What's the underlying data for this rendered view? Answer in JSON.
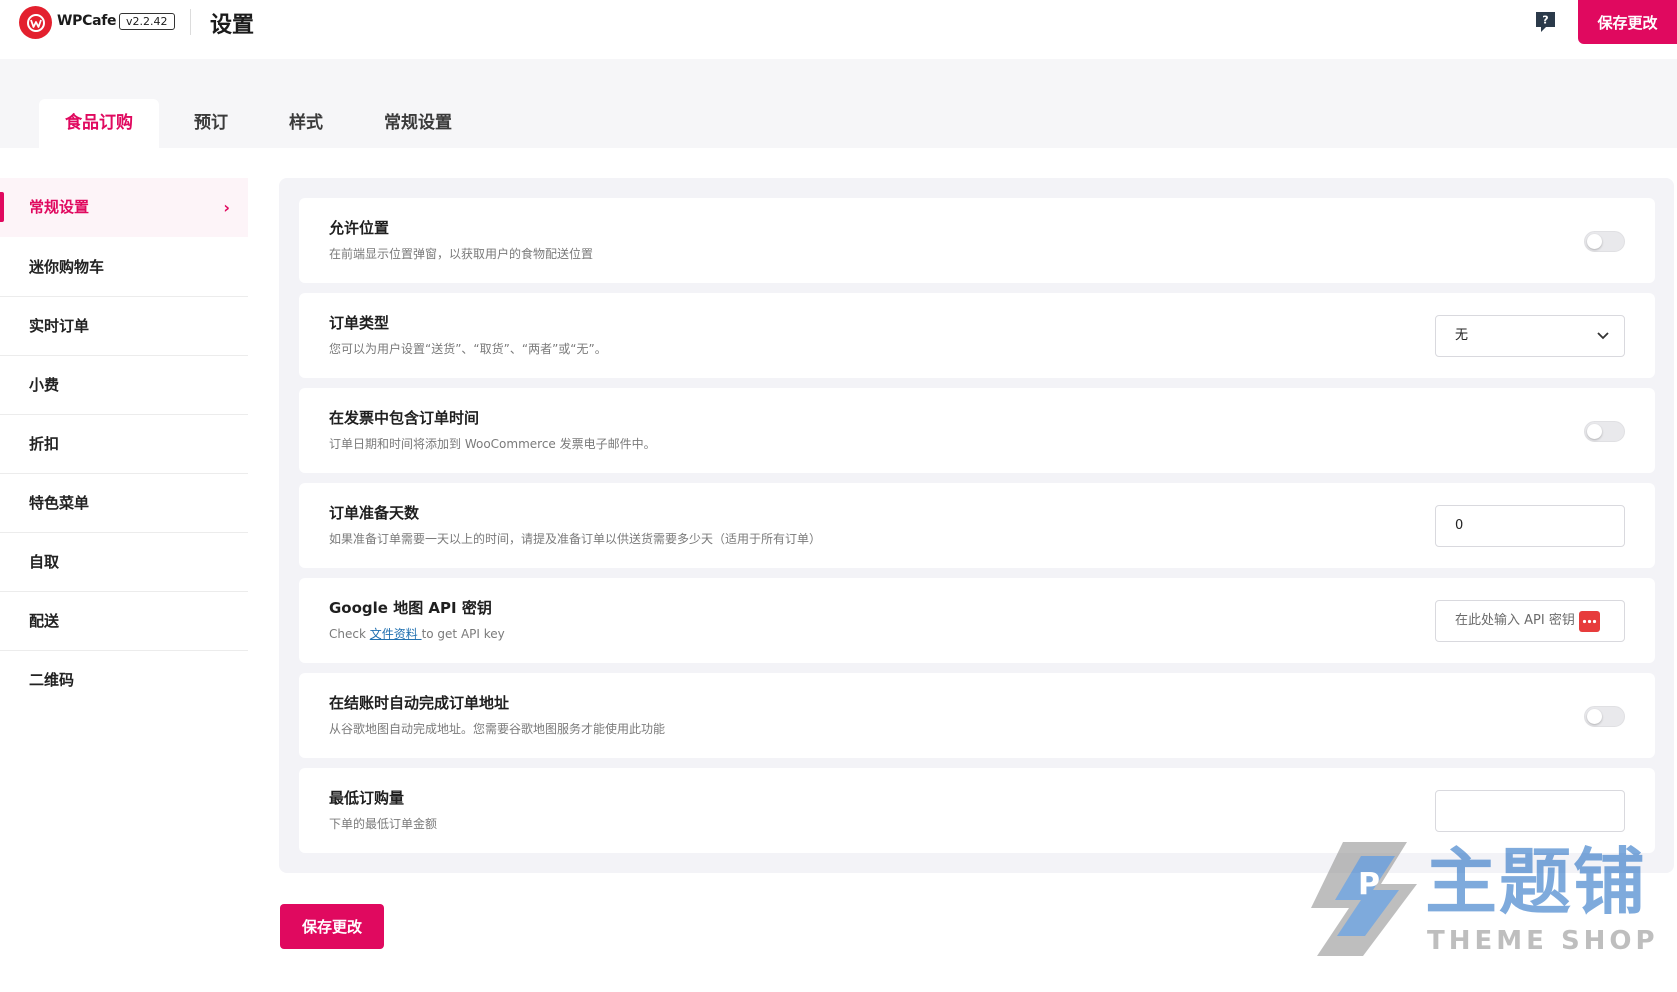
{
  "app": {
    "brand": "WPCafe",
    "version": "v2.2.42",
    "page_title": "设置",
    "save_label": "保存更改",
    "brand_color": "#e0095f"
  },
  "tabs": [
    {
      "label": "食品订购",
      "active": true
    },
    {
      "label": "预订",
      "active": false
    },
    {
      "label": "样式",
      "active": false
    },
    {
      "label": "常规设置",
      "active": false
    }
  ],
  "sidebar": {
    "items": [
      {
        "label": "常规设置",
        "active": true
      },
      {
        "label": "迷你购物车"
      },
      {
        "label": "实时订单"
      },
      {
        "label": "小费"
      },
      {
        "label": "折扣"
      },
      {
        "label": "特色菜单"
      },
      {
        "label": "自取"
      },
      {
        "label": "配送"
      },
      {
        "label": "二维码"
      }
    ]
  },
  "settings": [
    {
      "title": "允许位置",
      "desc": "在前端显示位置弹窗，以获取用户的食物配送位置",
      "control": "toggle",
      "enabled": false
    },
    {
      "title": "订单类型",
      "desc": "您可以为用户设置“送货”、“取货”、“两者”或“无”。",
      "control": "select",
      "value": "无"
    },
    {
      "title": "在发票中包含订单时间",
      "desc": "订单日期和时间将添加到 WooCommerce 发票电子邮件中。",
      "control": "toggle",
      "enabled": false
    },
    {
      "title": "订单准备天数",
      "desc": "如果准备订单需要一天以上的时间，请提及准备订单以供送货需要多少天（适用于所有订单）",
      "control": "input",
      "value": "0"
    },
    {
      "title": "Google 地图 API 密钥",
      "desc_prefix": "Check ",
      "desc_link": "文件资料 ",
      "desc_suffix": "to get API key",
      "control": "input",
      "placeholder": "在此处输入 API 密钥"
    },
    {
      "title": "在结账时自动完成订单地址",
      "desc": "从谷歌地图自动完成地址。您需要谷歌地图服务才能使用此功能",
      "control": "toggle",
      "enabled": false
    },
    {
      "title": "最低订购量",
      "desc": "下单的最低订单金额",
      "control": "input",
      "value": ""
    }
  ],
  "watermark": {
    "cn": "主题铺",
    "en": "THEME SHOP"
  }
}
